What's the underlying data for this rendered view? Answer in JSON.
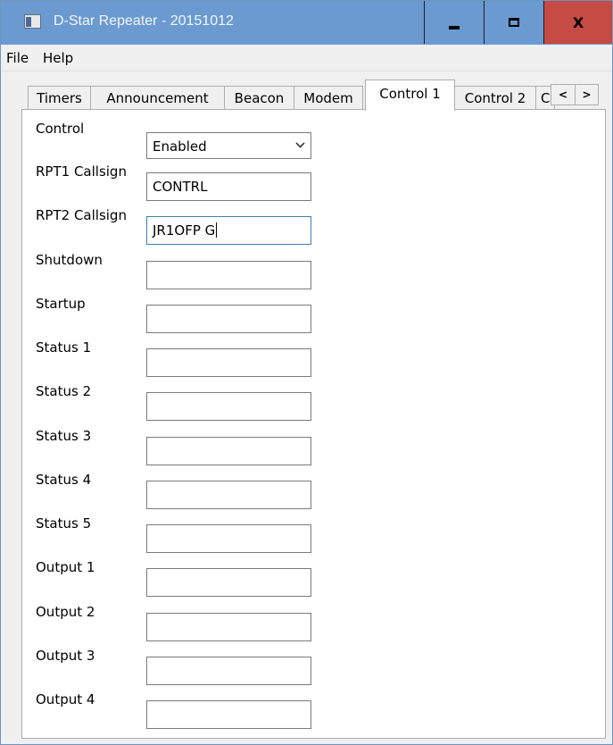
{
  "window": {
    "title": "D-Star Repeater - 20151012",
    "close_glyph": "X"
  },
  "menu": {
    "file": "File",
    "help": "Help"
  },
  "tabs": [
    {
      "label": "Timers"
    },
    {
      "label": "Announcement"
    },
    {
      "label": "Beacon"
    },
    {
      "label": "Modem"
    },
    {
      "label": "Control 1",
      "active": true
    },
    {
      "label": "Control 2"
    },
    {
      "label": "C"
    }
  ],
  "tab_scroll": {
    "left": "<",
    "right": ">"
  },
  "control": {
    "label": "Control",
    "value": "Enabled"
  },
  "fields": [
    {
      "label": "RPT1 Callsign",
      "value": "CONTRL"
    },
    {
      "label": "RPT2 Callsign",
      "value": "JR1OFP G"
    },
    {
      "label": "Shutdown",
      "value": ""
    },
    {
      "label": "Startup",
      "value": ""
    },
    {
      "label": "Status 1",
      "value": ""
    },
    {
      "label": "Status 2",
      "value": ""
    },
    {
      "label": "Status 3",
      "value": ""
    },
    {
      "label": "Status 4",
      "value": ""
    },
    {
      "label": "Status 5",
      "value": ""
    },
    {
      "label": "Output 1",
      "value": ""
    },
    {
      "label": "Output 2",
      "value": ""
    },
    {
      "label": "Output 3",
      "value": ""
    },
    {
      "label": "Output 4",
      "value": ""
    }
  ]
}
